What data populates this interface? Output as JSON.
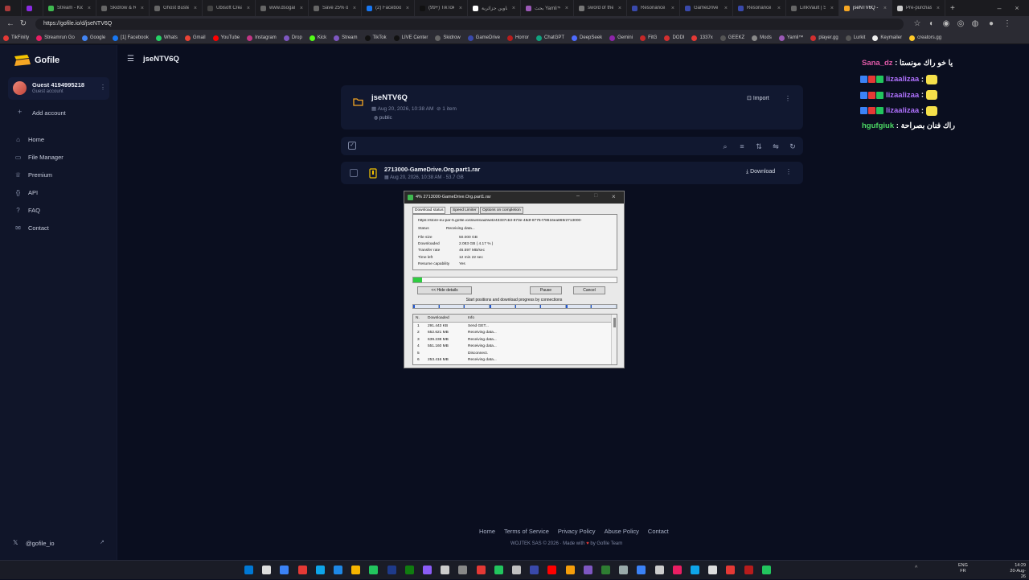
{
  "browser": {
    "tabs": [
      {
        "label": "",
        "color": "#a83a3a"
      },
      {
        "label": "",
        "color": "#8a2be2"
      },
      {
        "label": "Stream - Kick",
        "color": "#3fb950"
      },
      {
        "label": "Skidrow & Re",
        "color": "#666666"
      },
      {
        "label": "Ghost Buster",
        "color": "#666666"
      },
      {
        "label": "Ubisoft Creati",
        "color": "#444444"
      },
      {
        "label": "www.dsogam",
        "color": "#666666"
      },
      {
        "label": "Save 25% on",
        "color": "#666666"
      },
      {
        "label": "(2) Facebook",
        "color": "#1877f2"
      },
      {
        "label": "(99+) TikTok -",
        "color": "#111111"
      },
      {
        "label": "عناوين جزائرية",
        "color": "#ffffff"
      },
      {
        "label": "بحث Yamli™",
        "color": "#9b59b6"
      },
      {
        "label": "sword of the",
        "color": "#777777"
      },
      {
        "label": "Resonance A",
        "color": "#3949ab"
      },
      {
        "label": "GameDrive -",
        "color": "#3949ab"
      },
      {
        "label": "Resonance A",
        "color": "#3949ab"
      },
      {
        "label": "LinkVault | Se",
        "color": "#666666"
      },
      {
        "label": "jseNTV6Q - G",
        "color": "#f5a623"
      },
      {
        "label": "Pre-purchase",
        "color": "#cccccc"
      }
    ],
    "new_tab": "+",
    "url": "https://gofile.io/d/jseNTV6Q",
    "bookmarks": [
      {
        "label": "TikFinity",
        "color": "#e53935"
      },
      {
        "label": "Streamrun Go",
        "color": "#e91e63"
      },
      {
        "label": "Google",
        "color": "#4285f4"
      },
      {
        "label": "[1] Facebook",
        "color": "#1877f2"
      },
      {
        "label": "Whats",
        "color": "#25d366"
      },
      {
        "label": "Gmail",
        "color": "#ea4335"
      },
      {
        "label": "YouTube",
        "color": "#ff0000"
      },
      {
        "label": "Instagram",
        "color": "#c13584"
      },
      {
        "label": "Drop",
        "color": "#7e57c2"
      },
      {
        "label": "Kick",
        "color": "#53fc18"
      },
      {
        "label": "Stream",
        "color": "#7e57c2"
      },
      {
        "label": "TikTok",
        "color": "#111111"
      },
      {
        "label": "LIVE Center",
        "color": "#111111"
      },
      {
        "label": "Skidrow",
        "color": "#666666"
      },
      {
        "label": "GameDrive",
        "color": "#3949ab"
      },
      {
        "label": "Horror",
        "color": "#b71c1c"
      },
      {
        "label": "ChatGPT",
        "color": "#10a37f"
      },
      {
        "label": "DeepSeek",
        "color": "#4d6bfe"
      },
      {
        "label": "Gemini",
        "color": "#8e24aa"
      },
      {
        "label": "FitG",
        "color": "#c62828"
      },
      {
        "label": "DODI",
        "color": "#d32f2f"
      },
      {
        "label": "1337x",
        "color": "#e53935"
      },
      {
        "label": "GEEKZ",
        "color": "#555555"
      },
      {
        "label": "Mods",
        "color": "#888888"
      },
      {
        "label": "Yamli™",
        "color": "#9b59b6"
      },
      {
        "label": "player.gg",
        "color": "#d32f2f"
      },
      {
        "label": "Lurkit",
        "color": "#555555"
      },
      {
        "label": "Keymailer",
        "color": "#eeeeee"
      },
      {
        "label": "creators.gg",
        "color": "#ffca28"
      }
    ]
  },
  "sidebar": {
    "brand": "Gofile",
    "account_name": "Guest 4194995218",
    "account_type": "Guest account",
    "add_account": "Add account",
    "nav": [
      {
        "label": "Home",
        "icon": "⌂"
      },
      {
        "label": "File Manager",
        "icon": "▭"
      },
      {
        "label": "Premium",
        "icon": "♕"
      },
      {
        "label": "API",
        "icon": "{}"
      },
      {
        "label": "FAQ",
        "icon": "?"
      },
      {
        "label": "Contact",
        "icon": "✉"
      }
    ],
    "social": "@gofile_io"
  },
  "header": {
    "title": "jseNTV6Q"
  },
  "folder": {
    "name": "jseNTV6Q",
    "date": "Aug 20, 2026, 10:38 AM",
    "item_count": "1 item",
    "visibility": "public",
    "import_label": "Import"
  },
  "file": {
    "name": "2713000-GameDrive.Org.part1.rar",
    "date": "Aug 20, 2026, 10:38 AM",
    "size": "53.7 GB",
    "download_label": "Download"
  },
  "download_dialog": {
    "title": "4% 2713000-GameDrive.Org.part1.rar",
    "tabs": [
      "Download status",
      "Speed Limiter",
      "Options on completion"
    ],
    "url": "https://store-eu-par-5.gofile.io/download/web/43337cb3-873e-48df-8775-f78616ea869/2713000-",
    "status_label": "Status",
    "status_value": "Receiving data...",
    "fields": [
      {
        "k": "File size",
        "v": "50.000  GB"
      },
      {
        "k": "Downloaded",
        "v": "2.083  GB  ( 4.17 % )"
      },
      {
        "k": "Transfer rate",
        "v": "46.597  MB/sec"
      },
      {
        "k": "Time left",
        "v": "12 min 22 sec"
      },
      {
        "k": "Resume capability",
        "v": "Yes"
      }
    ],
    "progress": 0.0417,
    "hide_details": "<< Hide details",
    "pause": "Pause",
    "cancel": "Cancel",
    "connections_caption": "Start positions and download progress by connections",
    "columns": [
      "N.",
      "Downloaded",
      "Info"
    ],
    "rows": [
      {
        "n": "1",
        "downloaded": "291.443  KB",
        "info": "Send GET..."
      },
      {
        "n": "2",
        "downloaded": "652.621  MB",
        "info": "Receiving data..."
      },
      {
        "n": "3",
        "downloaded": "639.238  MB",
        "info": "Receiving data..."
      },
      {
        "n": "4",
        "downloaded": "551.160  MB",
        "info": "Receiving data..."
      },
      {
        "n": "5",
        "downloaded": "",
        "info": "Disconnect."
      },
      {
        "n": "6",
        "downloaded": "253.416  MB",
        "info": "Receiving data..."
      }
    ]
  },
  "footer": {
    "links": [
      "Home",
      "Terms of Service",
      "Privacy Policy",
      "Abuse Policy",
      "Contact"
    ],
    "made_left": "WOJTEK SAS © 2026 · Made with",
    "heart": "♥",
    "made_right": "by Gofile Team"
  },
  "chat": [
    {
      "user": "Sana_dz",
      "msg": "يا خو راك مونستا",
      "color": "#e05aa8"
    },
    {
      "user": "lizaalizaa",
      "msg": "",
      "color": "#b072ff"
    },
    {
      "user": "lizaalizaa",
      "msg": "",
      "color": "#b072ff"
    },
    {
      "user": "lizaalizaa",
      "msg": "",
      "color": "#b072ff"
    },
    {
      "user": "hgufgiuk",
      "msg": "راك فنان بصراحة",
      "color": "#4cd964"
    }
  ],
  "tray": {
    "lang_top": "ENG",
    "lang_bottom": "FR",
    "time": "14:29",
    "date": "20-Aug-26"
  }
}
